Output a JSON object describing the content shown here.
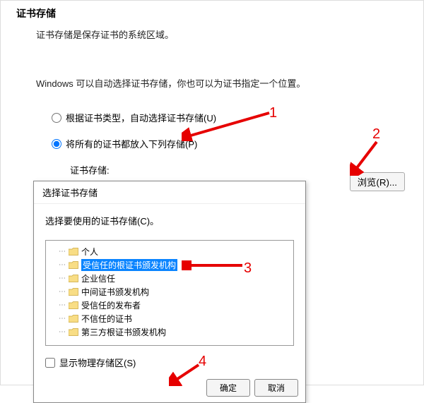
{
  "header": {
    "title": "证书存储",
    "desc": "证书存储是保存证书的系统区域。"
  },
  "explanation": "Windows 可以自动选择证书存储，你也可以为证书指定一个位置。",
  "radios": {
    "auto": "根据证书类型，自动选择证书存储(U)",
    "manual": "将所有的证书都放入下列存储(P)"
  },
  "store_label": "证书存储:",
  "browse_label": "浏览(R)...",
  "dialog": {
    "title": "选择证书存储",
    "prompt": "选择要使用的证书存储(C)。",
    "tree": [
      "个人",
      "受信任的根证书颁发机构",
      "企业信任",
      "中间证书颁发机构",
      "受信任的发布者",
      "不信任的证书",
      "第三方根证书颁发机构"
    ],
    "selected_index": 1,
    "show_physical": "显示物理存储区(S)",
    "ok": "确定",
    "cancel": "取消"
  },
  "annotations": {
    "1": "1",
    "2": "2",
    "3": "3",
    "4": "4"
  }
}
